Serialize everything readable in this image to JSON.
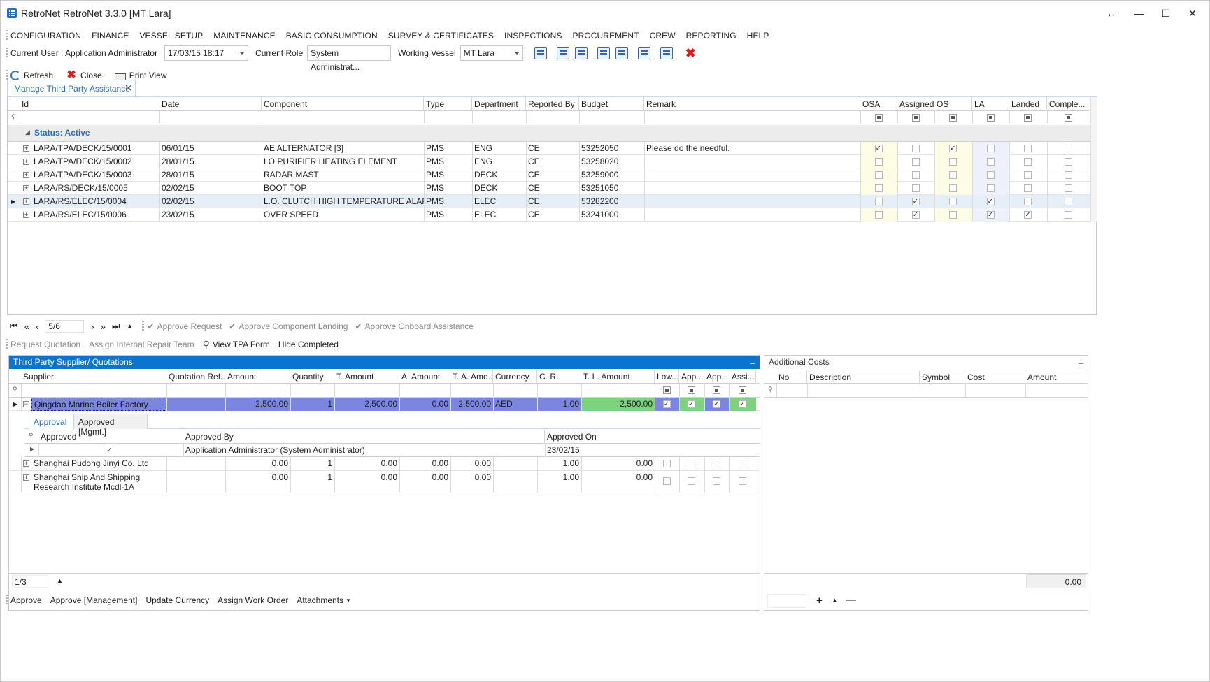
{
  "window": {
    "title": "RetroNet RetroNet 3.3.0 [MT Lara]",
    "buttons": [
      "↔",
      "—",
      "☐",
      "✕"
    ]
  },
  "menu": [
    "CONFIGURATION",
    "FINANCE",
    "VESSEL SETUP",
    "MAINTENANCE",
    "BASIC CONSUMPTION",
    "SURVEY & CERTIFICATES",
    "INSPECTIONS",
    "PROCUREMENT",
    "CREW",
    "REPORTING",
    "HELP"
  ],
  "userbar": {
    "current_user": "Current User : Application Administrator",
    "date_value": "17/03/15 18:17",
    "role_label": "Current Role",
    "role_value": "System Administrat...",
    "vessel_label": "Working Vessel",
    "vessel_value": "MT Lara"
  },
  "actions": {
    "refresh": "Refresh",
    "close": "Close",
    "print": "Print View"
  },
  "doc_tab": "Manage Third Party Assistance",
  "main_grid": {
    "columns": [
      "Id",
      "Date",
      "Component",
      "Type",
      "Department",
      "Reported By",
      "Budget",
      "Remark",
      "OSA",
      "Assigned",
      "OS",
      "LA",
      "Landed",
      "Comple..."
    ],
    "group_label": "Status: Active",
    "rows": [
      {
        "id": "LARA/TPA/DECK/15/0001",
        "date": "06/01/15",
        "component": "AE ALTERNATOR [3]",
        "type": "PMS",
        "dept": "ENG",
        "by": "CE",
        "budget": "53252050",
        "remark": "Please do the needful.",
        "flags": [
          true,
          false,
          true,
          false,
          false,
          false
        ]
      },
      {
        "id": "LARA/TPA/DECK/15/0002",
        "date": "28/01/15",
        "component": "LO PURIFIER HEATING ELEMENT",
        "type": "PMS",
        "dept": "ENG",
        "by": "CE",
        "budget": "53258020",
        "remark": "",
        "flags": [
          false,
          false,
          false,
          false,
          false,
          false
        ]
      },
      {
        "id": "LARA/TPA/DECK/15/0003",
        "date": "28/01/15",
        "component": "RADAR MAST",
        "type": "PMS",
        "dept": "DECK",
        "by": "CE",
        "budget": "53259000",
        "remark": "",
        "flags": [
          false,
          false,
          false,
          false,
          false,
          false
        ]
      },
      {
        "id": "LARA/RS/DECK/15/0005",
        "date": "02/02/15",
        "component": "BOOT TOP",
        "type": "PMS",
        "dept": "DECK",
        "by": "CE",
        "budget": "53251050",
        "remark": "",
        "flags": [
          false,
          false,
          false,
          false,
          false,
          false
        ]
      },
      {
        "id": "LARA/RS/ELEC/15/0004",
        "date": "02/02/15",
        "component": "L.O. CLUTCH HIGH TEMPERATURE ALARM",
        "type": "PMS",
        "dept": "ELEC",
        "by": "CE",
        "budget": "53282200",
        "remark": "",
        "flags": [
          false,
          true,
          false,
          true,
          false,
          false
        ]
      },
      {
        "id": "LARA/RS/ELEC/15/0006",
        "date": "23/02/15",
        "component": "OVER SPEED",
        "type": "PMS",
        "dept": "ELEC",
        "by": "CE",
        "budget": "53241000",
        "remark": "",
        "flags": [
          false,
          true,
          false,
          true,
          true,
          false
        ]
      }
    ]
  },
  "nav": {
    "position": "5/6",
    "approve_request": "Approve Request",
    "approve_landing": "Approve Component Landing",
    "approve_onboard": "Approve Onboard Assistance"
  },
  "subbar": {
    "request_quotation": "Request Quotation",
    "assign_internal": "Assign Internal Repair Team",
    "view_tpa": "View TPA Form",
    "hide_completed": "Hide Completed"
  },
  "supplier_panel": {
    "title": "Third Party Supplier/ Quotations",
    "columns": [
      "Supplier",
      "Quotation Ref...",
      "Amount",
      "Quantity",
      "T. Amount",
      "A. Amount",
      "T. A. Amo...",
      "Currency",
      "C. R.",
      "T. L. Amount",
      "Low...",
      "App...",
      "App...",
      "Assi..."
    ],
    "rows": [
      {
        "supplier": "Qingdao Marine Boiler Factory",
        "ref": "",
        "amount": "2,500.00",
        "qty": "1",
        "t_amount": "2,500.00",
        "a_amount": "0.00",
        "ta_amount": "2,500.00",
        "currency": "AED",
        "cr": "1.00",
        "tl_amount": "2,500.00",
        "flags": [
          true,
          true,
          true,
          true
        ]
      },
      {
        "supplier": "Shanghai Pudong Jinyi Co. Ltd",
        "ref": "",
        "amount": "0.00",
        "qty": "1",
        "t_amount": "0.00",
        "a_amount": "0.00",
        "ta_amount": "0.00",
        "currency": "",
        "cr": "1.00",
        "tl_amount": "0.00",
        "flags": [
          false,
          false,
          false,
          false
        ]
      },
      {
        "supplier": "Shanghai Ship And Shipping Research Institute Mcdl-1A",
        "ref": "",
        "amount": "0.00",
        "qty": "1",
        "t_amount": "0.00",
        "a_amount": "0.00",
        "ta_amount": "0.00",
        "currency": "",
        "cr": "1.00",
        "tl_amount": "0.00",
        "flags": [
          false,
          false,
          false,
          false
        ]
      }
    ],
    "detail_tabs": [
      "Approval",
      "Approved [Mgmt.]"
    ],
    "detail_columns": [
      "Approved",
      "Approved By",
      "Approved On"
    ],
    "detail_row": {
      "approved": true,
      "by": "Application Administrator (System Administrator)",
      "on": "23/02/15"
    },
    "pager": "1/3",
    "buttons": [
      "Approve",
      "Approve [Management]",
      "Update Currency",
      "Assign Work Order",
      "Attachments"
    ]
  },
  "costs_panel": {
    "title": "Additional Costs",
    "columns": [
      "No",
      "Description",
      "Symbol",
      "Cost",
      "Amount"
    ],
    "total": "0.00"
  },
  "colors": {
    "accent": "#0a74d1",
    "selected_row": "#7b86e0",
    "green_cell": "#7ed17e",
    "link": "#2b6cb8",
    "osa_bg": "#fdfde6",
    "os_bg": "#fdfde6",
    "la_bg": "#eef1fb"
  }
}
